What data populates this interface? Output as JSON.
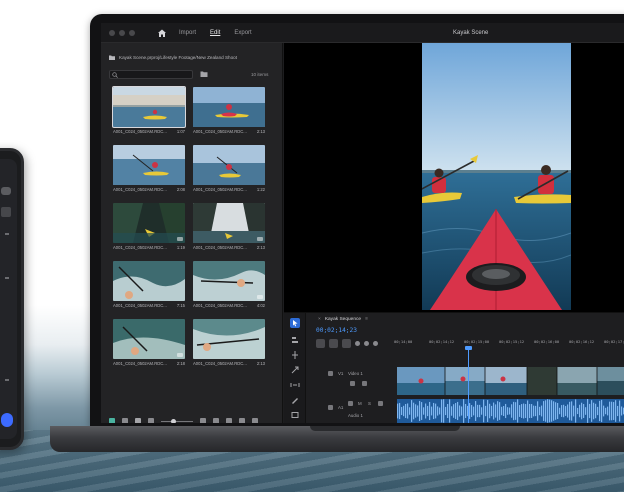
{
  "window": {
    "title": "Kayak Scene",
    "nav": {
      "import": "Import",
      "edit": "Edit",
      "export": "Export"
    }
  },
  "media": {
    "path": "Kayak Scene.prproj/Lifestyle Footage/New Zealand Shoot",
    "count": "10 items",
    "clips": [
      {
        "name": "A001_C024_0502AM.RDC...",
        "duration": "1:07"
      },
      {
        "name": "A001_C024_0502AM.RDC...",
        "duration": "2:13"
      },
      {
        "name": "A001_C024_0502AM.RDC...",
        "duration": "2:08"
      },
      {
        "name": "A001_C024_0502AM.RDC...",
        "duration": "1:22"
      },
      {
        "name": "A001_C024_0502AM.RDC...",
        "duration": "1:19"
      },
      {
        "name": "A001_C024_0502AM.RDC...",
        "duration": "2:13"
      },
      {
        "name": "A001_C024_0502AM.RDC...",
        "duration": "7:15"
      },
      {
        "name": "A001_C024_0502AM.RDC...",
        "duration": "4:02"
      },
      {
        "name": "A001_C024_0502AM.RDC...",
        "duration": "2:18"
      },
      {
        "name": "A001_C024_0502AM.RDC...",
        "duration": "2:13"
      }
    ]
  },
  "timeline": {
    "sequence_name": "Kayak Sequence",
    "close": "≡",
    "timecode": "00;02;14;23",
    "ruler": [
      "00;14;00",
      "00;02;14;12",
      "00;02;15;00",
      "00;02;15;12",
      "00;02;16;00",
      "00;02;16;12",
      "00;02;17;0"
    ],
    "video_track": {
      "id": "V1",
      "name": "Video 1"
    },
    "audio_track": {
      "id": "A1",
      "name": "Audio 1",
      "m": "M",
      "s": "S"
    }
  },
  "colors": {
    "accent_blue": "#4e9bff",
    "selection_blue": "#2d6bd6",
    "kayak_red": "#d9334a",
    "audio_blue": "#1f5a9a"
  }
}
